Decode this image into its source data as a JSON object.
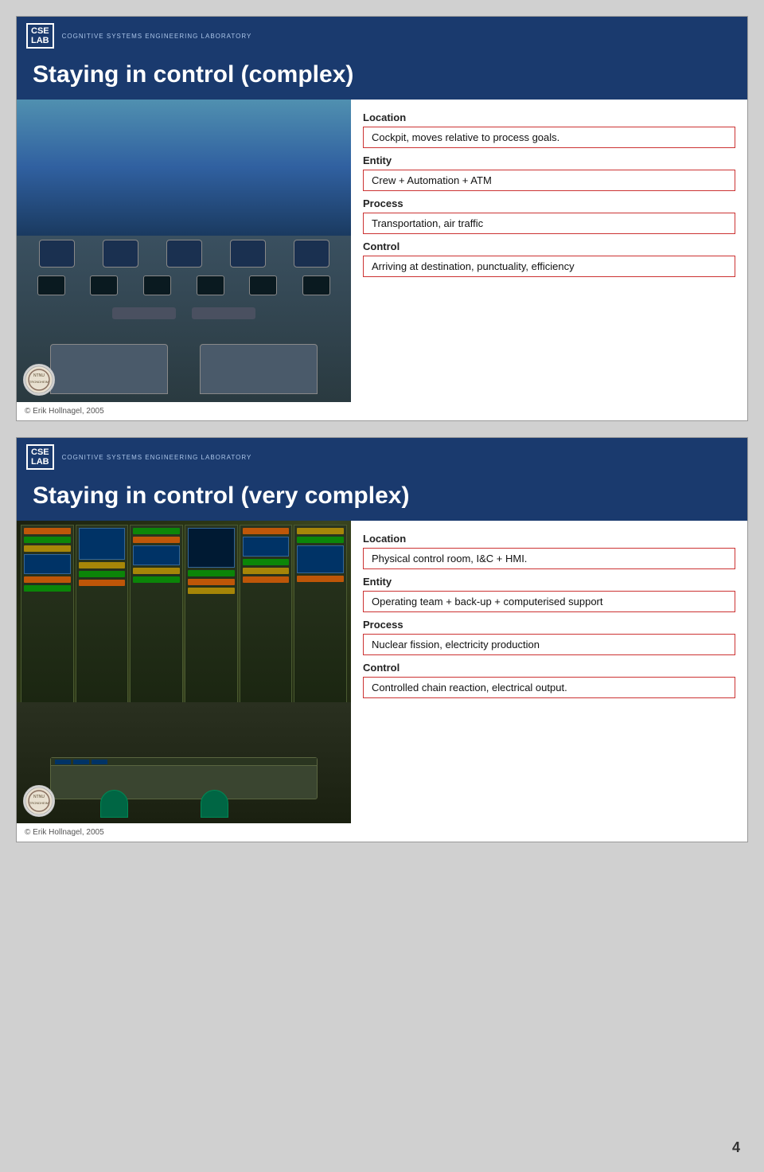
{
  "page": {
    "number": "4",
    "background": "#d0d0d0"
  },
  "slide1": {
    "header": {
      "lab_line1": "CSE",
      "lab_line2": "LAB",
      "small_text": "COGNITIVE SYSTEMS ENGINEERING LABORATORY"
    },
    "title": "Staying in control (complex)",
    "location_label": "Location",
    "location_value": "Cockpit, moves relative to process goals.",
    "entity_label": "Entity",
    "entity_value": "Crew + Automation + ATM",
    "process_label": "Process",
    "process_value": "Transportation, air traffic",
    "control_label": "Control",
    "control_value": "Arriving at destination, punctuality, efficiency",
    "copyright": "© Erik Hollnagel, 2005"
  },
  "slide2": {
    "header": {
      "lab_line1": "CSE",
      "lab_line2": "LAB",
      "small_text": "COGNITIVE SYSTEMS ENGINEERING LABORATORY"
    },
    "title": "Staying in control (very complex)",
    "location_label": "Location",
    "location_value": "Physical control room, I&C + HMI.",
    "entity_label": "Entity",
    "entity_value": "Operating team + back-up + computerised support",
    "process_label": "Process",
    "process_value": "Nuclear fission, electricity production",
    "control_label": "Control",
    "control_value": "Controlled chain reaction, electrical output.",
    "copyright": "© Erik Hollnagel, 2005"
  }
}
